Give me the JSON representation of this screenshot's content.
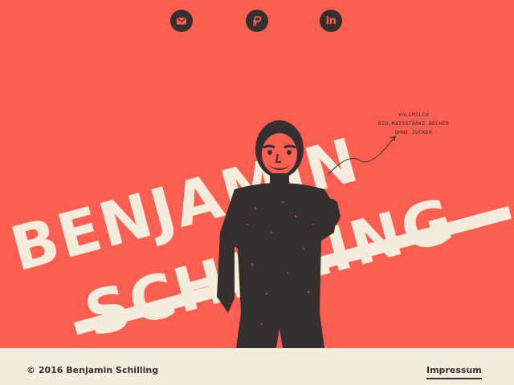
{
  "social": {
    "mail_icon": "envelope-icon",
    "paypal_icon": "paypal-icon",
    "linkedin_icon": "linkedin-icon",
    "linkedin_text": "in"
  },
  "hero": {
    "first_name": "BENJAMIN",
    "last_name": "SCHILLING",
    "note_lines": [
      "VOLLMILCH",
      "BIO-MAISSTÄRKE-BECHER",
      "OHNE ZUCKER"
    ]
  },
  "footer": {
    "copyright": "© 2016 Benjamin Schilling",
    "impressum": "Impressum"
  },
  "colors": {
    "background": "#fb5f52",
    "text_light": "#f4ecdd",
    "dark": "#35302f"
  }
}
